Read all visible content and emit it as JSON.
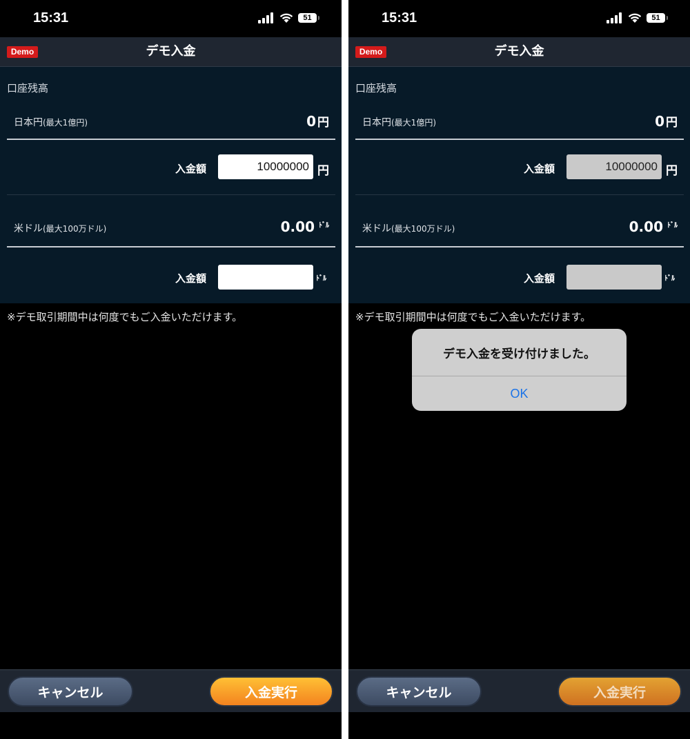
{
  "status": {
    "time": "15:31",
    "battery": "51"
  },
  "nav": {
    "badge": "Demo",
    "title": "デモ入金"
  },
  "account": {
    "section_label": "口座残高",
    "jpy": {
      "label": "日本円",
      "limit": "(最大1億円)",
      "balance": "0",
      "unit": "円",
      "amount_label": "入金額",
      "amount_value": "10000000",
      "amount_unit": "円"
    },
    "usd": {
      "label": "米ドル",
      "limit": "(最大100万ドル)",
      "balance": "0.00",
      "unit": "ﾄﾞﾙ",
      "amount_label": "入金額",
      "amount_value": "",
      "amount_unit": "ﾄﾞﾙ"
    }
  },
  "note": "※デモ取引期間中は何度でもご入金いただけます。",
  "buttons": {
    "cancel": "キャンセル",
    "execute": "入金実行"
  },
  "dialog": {
    "message": "デモ入金を受け付けました。",
    "ok": "OK"
  },
  "colors": {
    "panel": "#071a28",
    "navbar": "#1f2631",
    "badge": "#d41b1b",
    "execute": "#f7a02a",
    "ok": "#1a73e8"
  }
}
